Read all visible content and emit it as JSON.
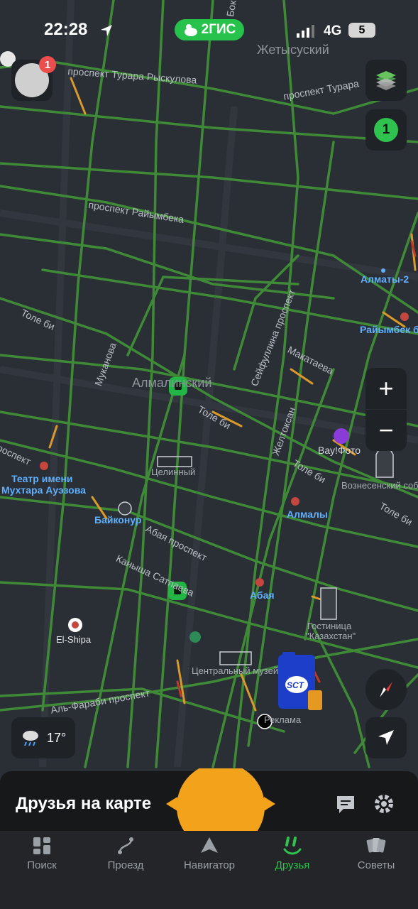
{
  "status_bar": {
    "time": "22:28",
    "brand": "2ГИС",
    "network": "4G",
    "battery": "5"
  },
  "map": {
    "districts": [
      "Жетысуский",
      "Алмалинский"
    ],
    "streets": [
      "проспект Турара Рыскулова",
      "проспект Турара",
      "проспект Райымбека",
      "Толе би",
      "Толе би",
      "Толе би",
      "Толе би",
      "Муканова",
      "Сейфуллина проспект",
      "Макатаева",
      "Желтоксан",
      "Абая проспект",
      "Каныша Сатпаева",
      "Аль-Фараби проспект",
      "роспект",
      "Бок"
    ],
    "pois": {
      "almaty2": "Алматы-2",
      "raiymbek": "Райымбек б",
      "vaufoto": "Вау!Фото",
      "voznesensky": "Вознесенский соб",
      "teatr_line1": "Театр имени",
      "teatr_line2": "Мухтара Ауэзова",
      "tselinny": "Целинный",
      "baikonur": "Байконур",
      "almaly": "Алмалы",
      "abaya": "Абая",
      "hotel_line1": "Гостиница",
      "hotel_line2": "\"Казахстан\"",
      "elshipa": "El-Shipa",
      "museum": "Центральный музей",
      "ad": "Реклама",
      "sct": "SCT"
    }
  },
  "controls": {
    "avatar_badge": "1",
    "friends_count": "1",
    "zoom_in": "+",
    "zoom_out": "−",
    "weather_temp": "17°"
  },
  "panel": {
    "title": "Друзья на карте"
  },
  "tabs": [
    "Поиск",
    "Проезд",
    "Навигатор",
    "Друзья",
    "Советы"
  ],
  "colors": {
    "accent": "#2fc24f",
    "map_bg": "#2a2e35",
    "road": "#3f8a37",
    "jam": "#d99a2b",
    "poi_blue": "#5fb0ff"
  }
}
